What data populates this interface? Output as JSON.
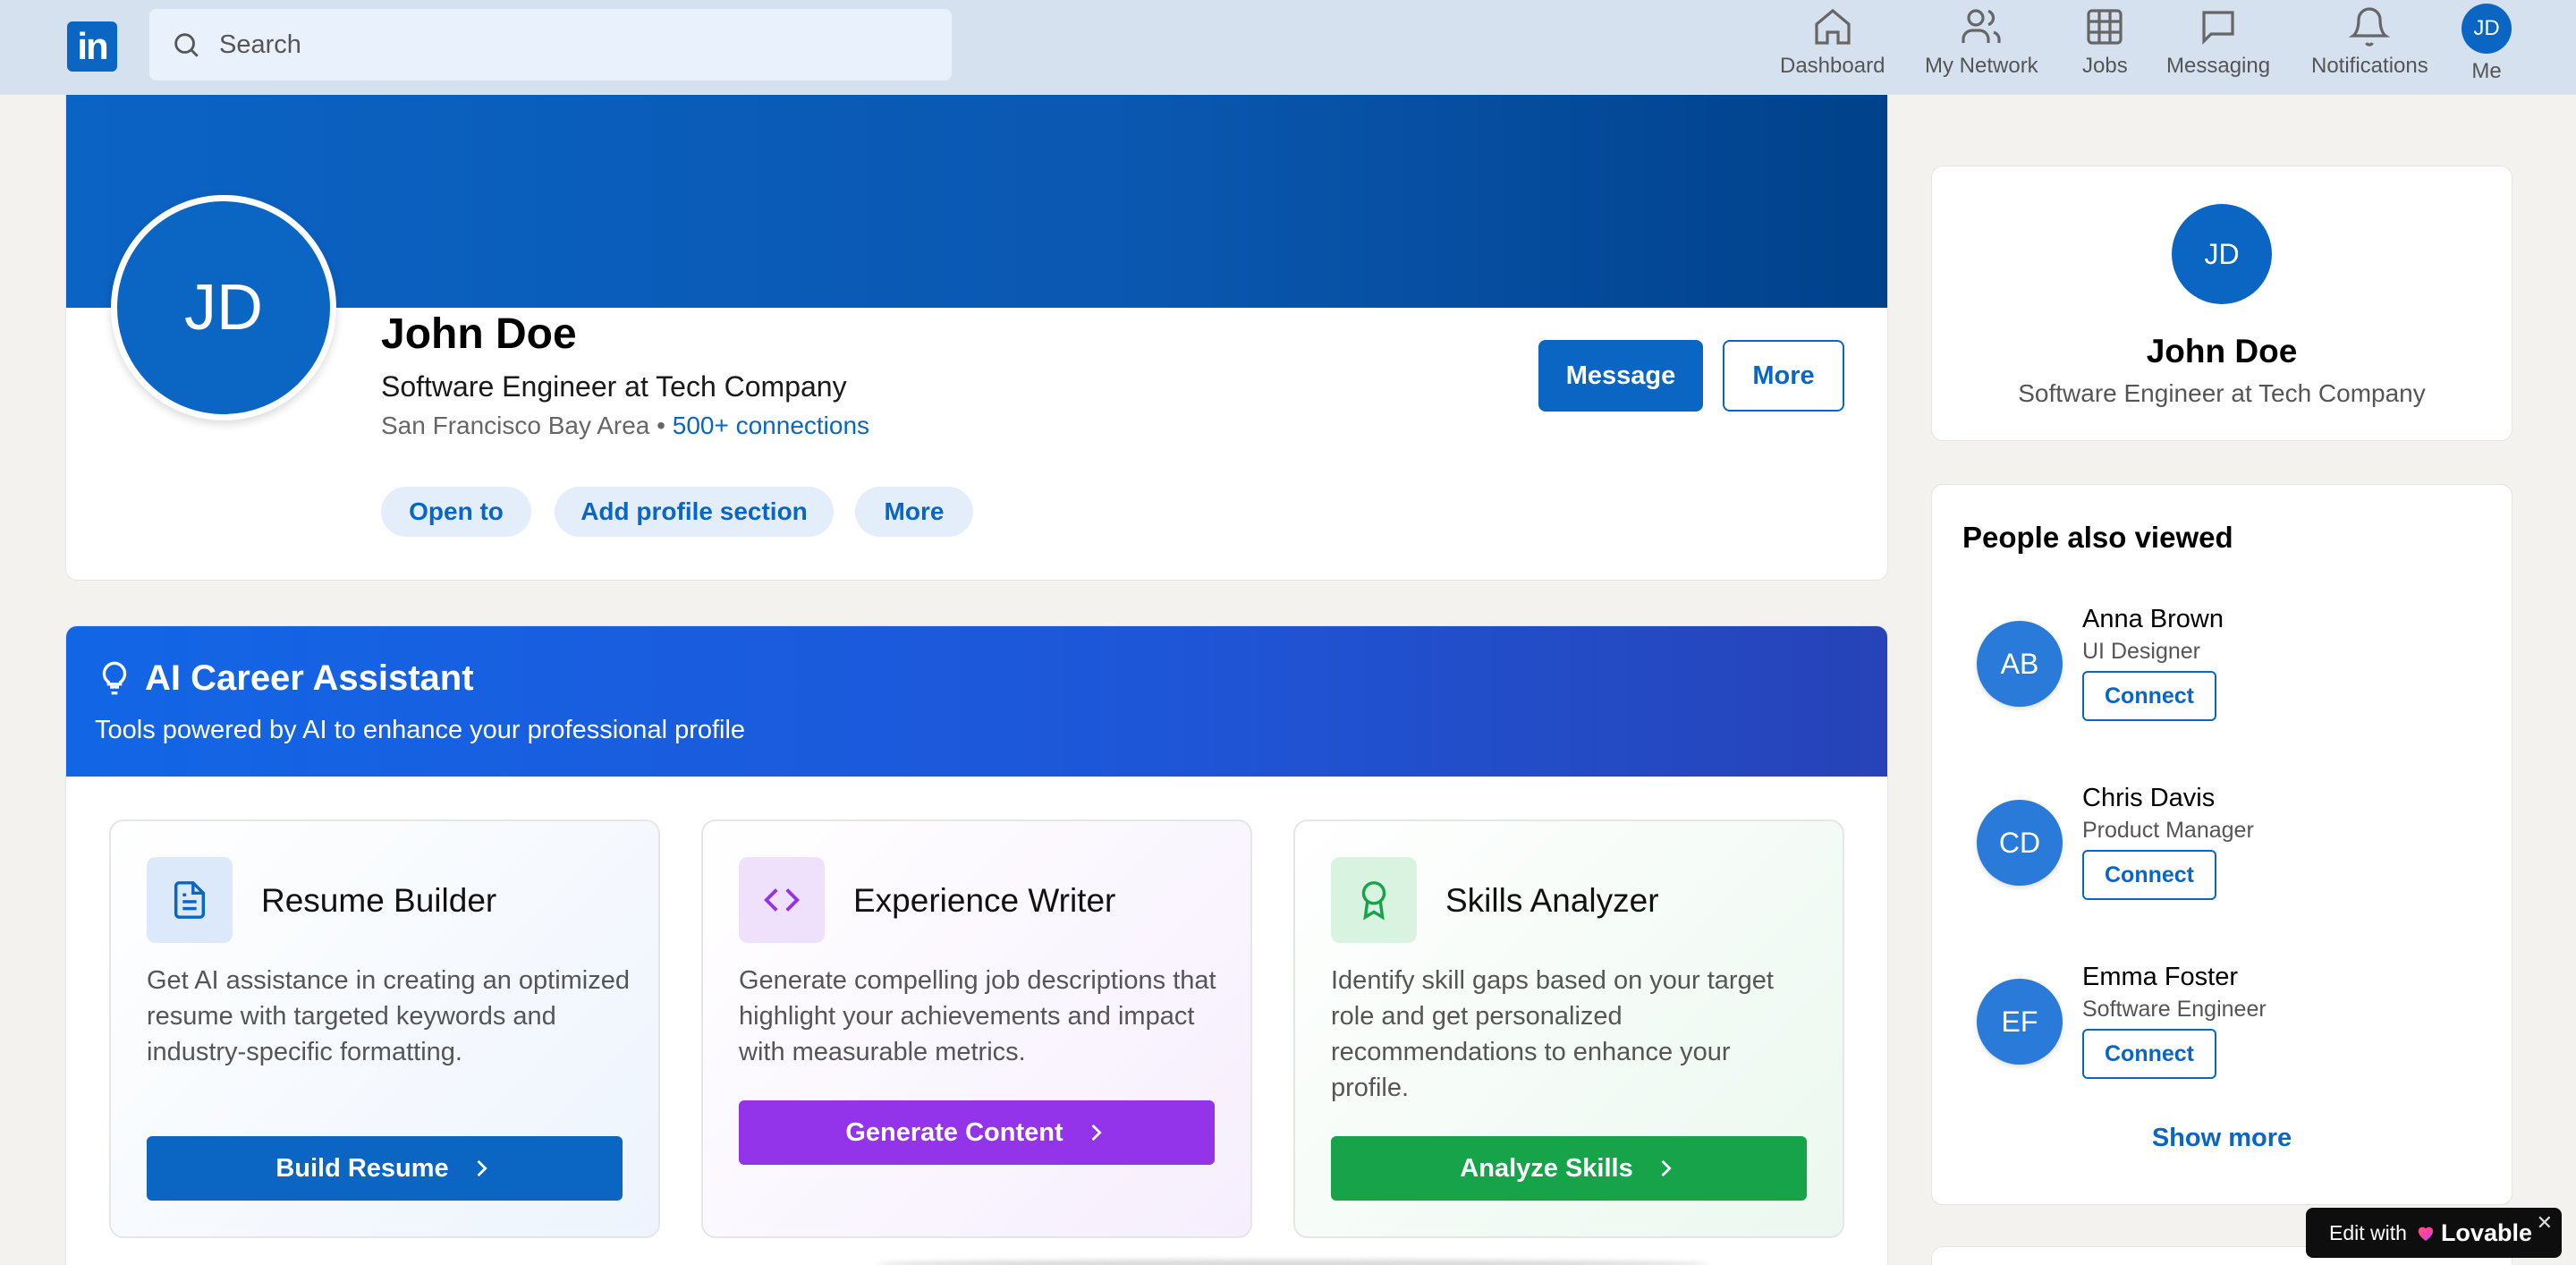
{
  "nav": {
    "logo": "in",
    "search_placeholder": "Search",
    "items": [
      {
        "label": "Dashboard",
        "icon": "home-icon"
      },
      {
        "label": "My Network",
        "icon": "network-icon"
      },
      {
        "label": "Jobs",
        "icon": "jobs-icon"
      },
      {
        "label": "Messaging",
        "icon": "messaging-icon"
      },
      {
        "label": "Notifications",
        "icon": "bell-icon"
      }
    ],
    "me_initials": "JD",
    "me_label": "Me"
  },
  "profile": {
    "initials": "JD",
    "name": "John Doe",
    "headline": "Software Engineer at Tech Company",
    "location": "San Francisco Bay Area",
    "separator": "•",
    "connections": "500+ connections",
    "message_button": "Message",
    "more_button": "More",
    "pills": [
      "Open to",
      "Add profile section",
      "More"
    ]
  },
  "ai_assistant": {
    "title": "AI Career Assistant",
    "subtitle": "Tools powered by AI to enhance your professional profile",
    "tools": [
      {
        "title": "Resume Builder",
        "description": "Get AI assistance in creating an optimized resume with targeted keywords and industry-specific formatting.",
        "button": "Build Resume",
        "icon": "document-icon",
        "accent": "#0a66c2"
      },
      {
        "title": "Experience Writer",
        "description": "Generate compelling job descriptions that highlight your achievements and impact with measurable metrics.",
        "button": "Generate Content",
        "icon": "code-icon",
        "accent": "#9333ea"
      },
      {
        "title": "Skills Analyzer",
        "description": "Identify skill gaps based on your target role and get personalized recommendations to enhance your profile.",
        "button": "Analyze Skills",
        "icon": "award-icon",
        "accent": "#16a34a"
      }
    ]
  },
  "sidebar": {
    "profile": {
      "initials": "JD",
      "name": "John Doe",
      "headline": "Software Engineer at Tech Company"
    },
    "people_also_viewed": {
      "title": "People also viewed",
      "people": [
        {
          "initials": "AB",
          "name": "Anna Brown",
          "role": "UI Designer",
          "button": "Connect"
        },
        {
          "initials": "CD",
          "name": "Chris Davis",
          "role": "Product Manager",
          "button": "Connect"
        },
        {
          "initials": "EF",
          "name": "Emma Foster",
          "role": "Software Engineer",
          "button": "Connect"
        }
      ],
      "show_more": "Show more"
    }
  },
  "badge": {
    "prefix": "Edit with",
    "brand": "Lovable",
    "close": "✕"
  }
}
